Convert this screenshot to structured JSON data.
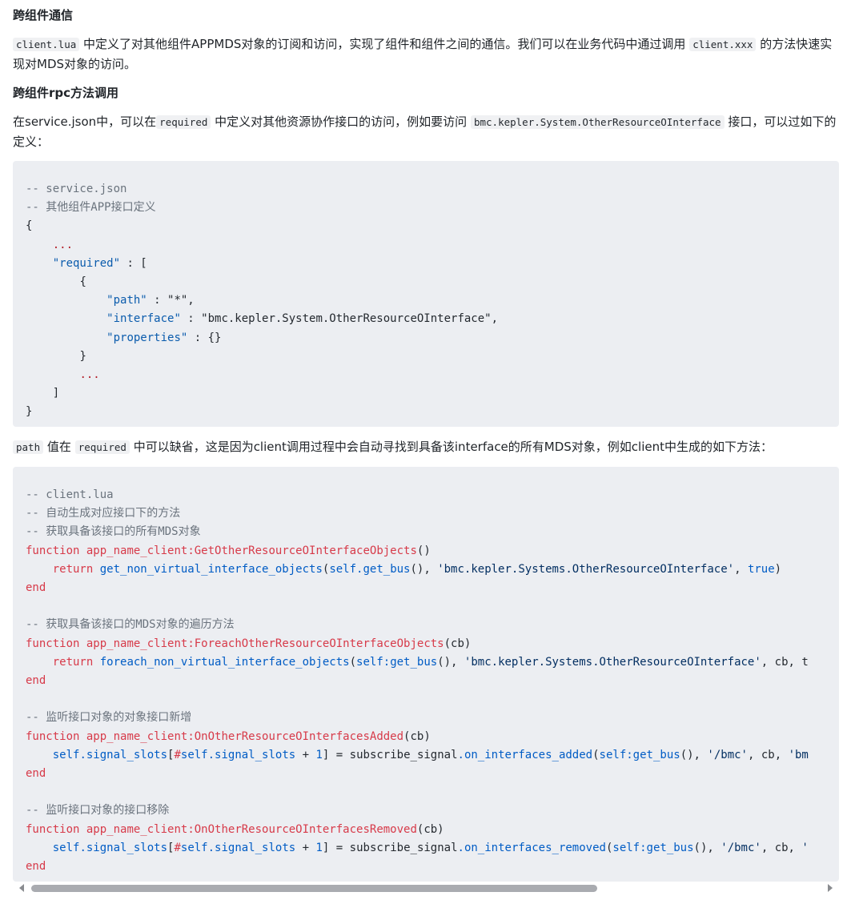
{
  "sections": {
    "heading1": "跨组件通信",
    "para1": {
      "code1": "client.lua",
      "text1": "中定义了对其他组件APPMDS对象的订阅和访问，实现了组件和组件之间的通信。我们可以在业务代码中通过调用",
      "code2": "client.xxx",
      "text2": "的方法快速实现对MDS对象的访问。"
    },
    "heading2": "跨组件rpc方法调用",
    "para2": {
      "text1": "在service.json中，可以在",
      "code1": "required",
      "text2": "中定义对其他资源协作接口的访问，例如要访问",
      "code2": "bmc.kepler.System.OtherResourceOInterface",
      "text3": "接口，可以过如下的定义："
    },
    "para3": {
      "code1": "path",
      "text1": "值在",
      "code2": "required",
      "text2": "中可以缺省，这是因为client调用过程中会自动寻找到具备该interface的所有MDS对象，例如client中生成的如下方法："
    }
  },
  "code_block_1": {
    "l1": "-- service.json",
    "l2": "-- 其他组件APP接口定义",
    "brace_open": "{",
    "dots": "...",
    "required_key": "\"required\"",
    "colon_bracket": " : [",
    "inner_open": "{",
    "path_key": "\"path\"",
    "path_val": " : \"*\",",
    "interface_key": "\"interface\"",
    "interface_val": " : \"bmc.kepler.System.OtherResourceOInterface\",",
    "properties_key": "\"properties\"",
    "properties_val": " : {}",
    "inner_close": "}",
    "bracket_close": "]",
    "brace_close": "}"
  },
  "code_block_2": {
    "c1": "-- client.lua",
    "c2": "-- 自动生成对应接口下的方法",
    "c3": "-- 获取具备该接口的所有MDS对象",
    "kw_function": "function",
    "kw_return": "return",
    "kw_end": "end",
    "kw_true": "true",
    "client_name": "app_name_client",
    "f1_name": ":GetOtherResourceOInterfaceObjects",
    "f1_args": "()",
    "r1_call": "get_non_virtual_interface_objects",
    "r1_a1": "(",
    "self": "self",
    "r1_bus": ".get_bus",
    "r1_a2": "(), ",
    "r1_str": "'bmc.kepler.Systems.OtherResourceOInterface'",
    "r1_a3": ", ",
    "r1_a4": ")",
    "c4": "-- 获取具备该接口的MDS对象的遍历方法",
    "f2_name": ":ForeachOtherResourceOInterfaceObjects",
    "f2_args": "(cb)",
    "r2_call": "foreach_non_virtual_interface_objects",
    "r2_bus": ":get_bus",
    "r2_str": "'bmc.kepler.Systems.OtherResourceOInterface'",
    "r2_tail": ", cb, t",
    "c5": "-- 监听接口对象的对象接口新增",
    "f3_name": ":OnOtherResourceOInterfacesAdded",
    "f3_args": "(cb)",
    "slots": ".signal_slots",
    "idx_open": "[",
    "hash": "#",
    "plus": " + ",
    "one": "1",
    "idx_close": "]",
    "assign": " = ",
    "sub": "subscribe_signal",
    "on_added": ".on_interfaces_added",
    "bus_colon": ":get_bus",
    "paren_open": "(",
    "paren_comma": "(), ",
    "bmc_str": "'/bmc'",
    "tail3": ", cb, ",
    "tail3_str": "'bm",
    "c6": "-- 监听接口对象的接口移除",
    "f4_name": ":OnOtherResourceOInterfacesRemoved",
    "f4_args": "(cb)",
    "on_removed": ".on_interfaces_removed",
    "tail4": ", cb, ",
    "tail4_str": "'"
  },
  "scrollbar": {
    "position": 0.0,
    "visible_fraction": 0.7
  }
}
